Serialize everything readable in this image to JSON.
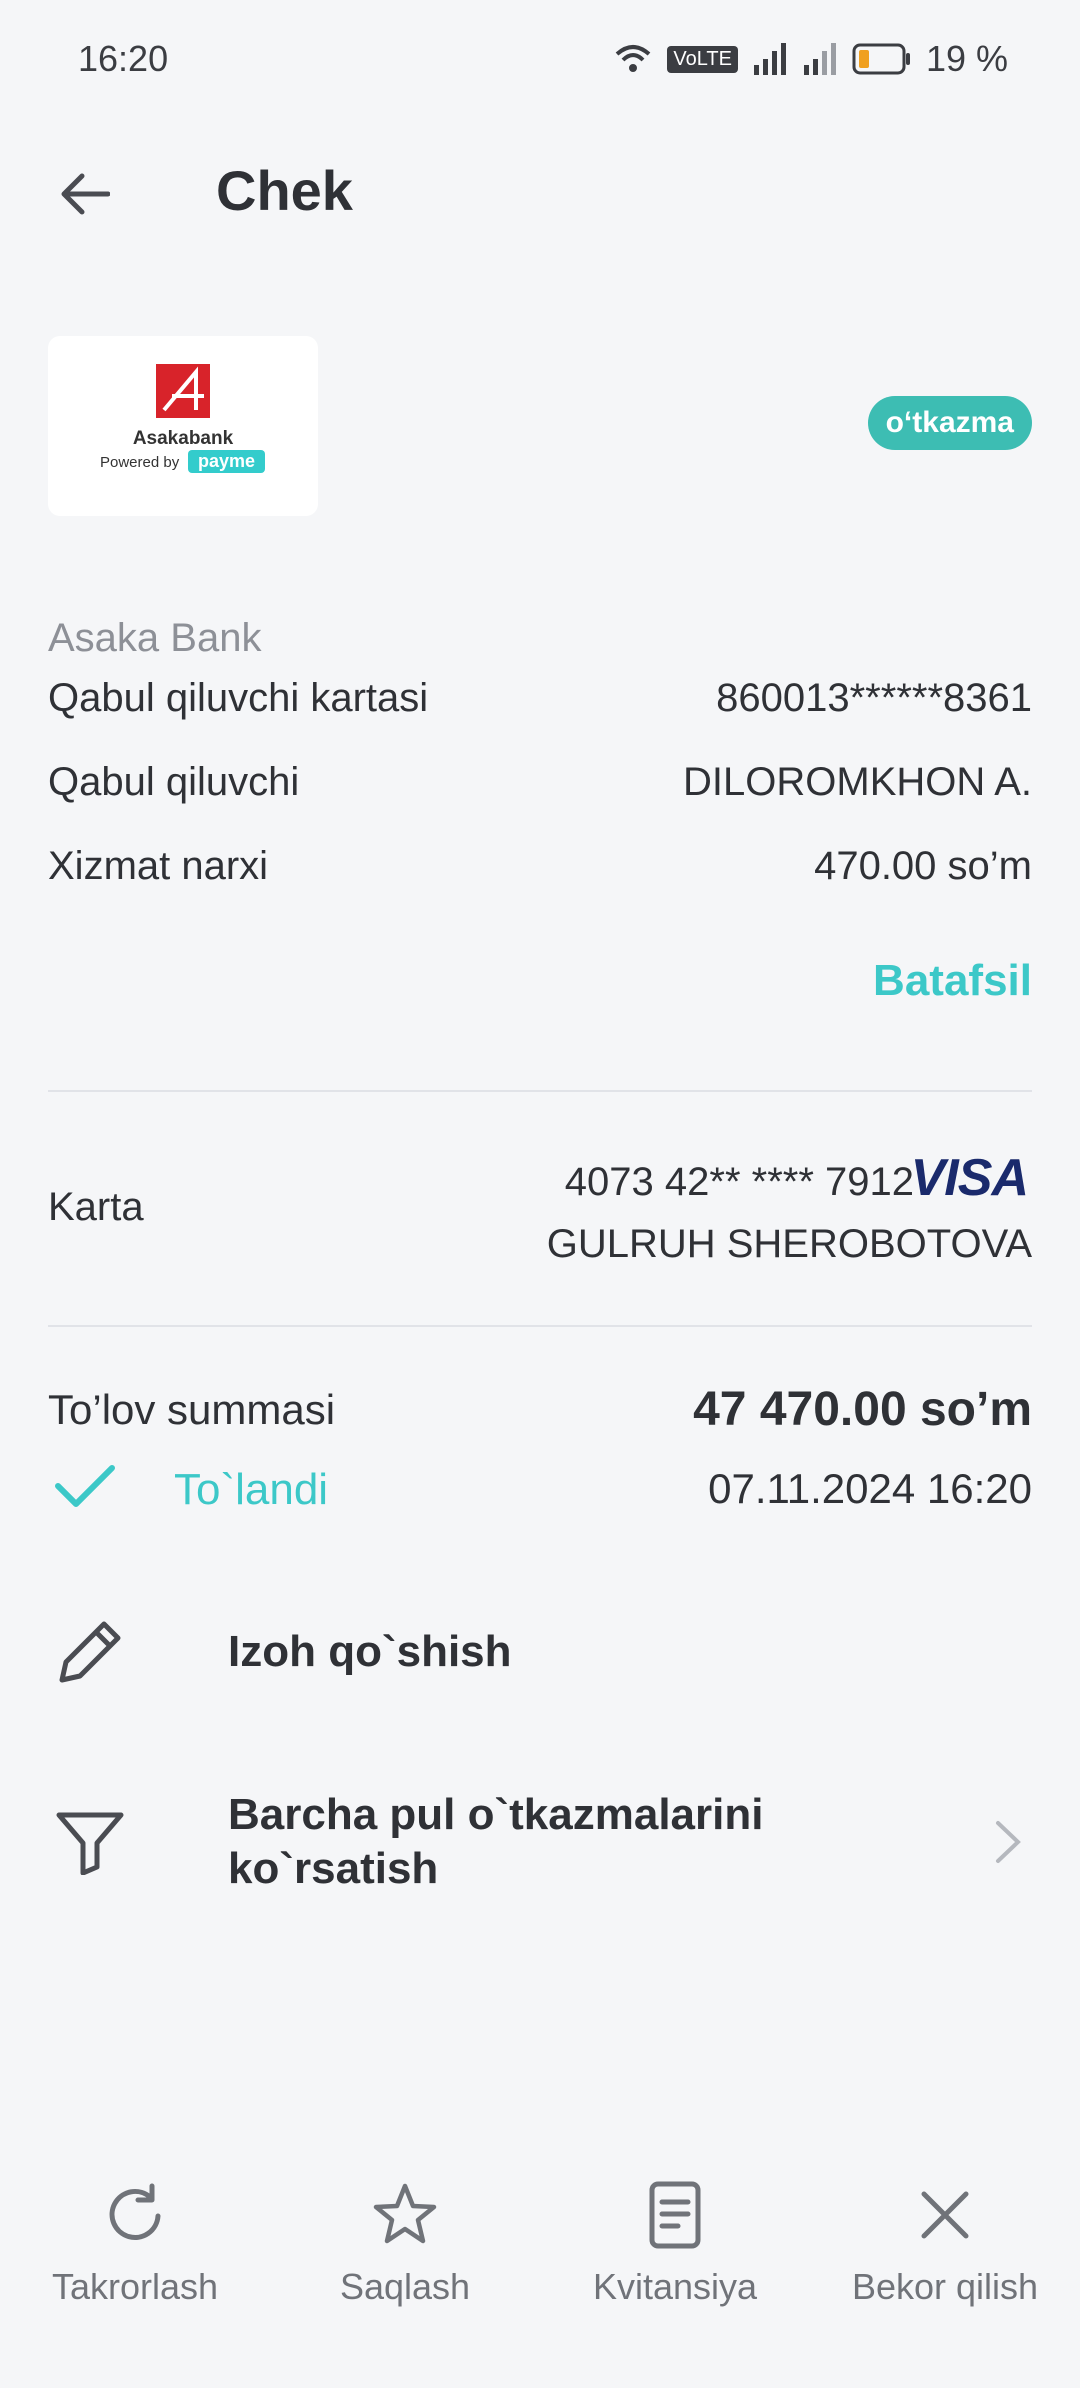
{
  "status_bar": {
    "time": "16:20",
    "battery": "19 %",
    "network": "VoLTE"
  },
  "header": {
    "title": "Chek"
  },
  "logo": {
    "bank_name": "Asakabank",
    "powered_by": "Powered by",
    "brand": "payme"
  },
  "badge": "o‘tkazma",
  "provider": "Asaka Bank",
  "details": [
    {
      "label": "Qabul qiluvchi kartasi",
      "value": "860013******8361"
    },
    {
      "label": "Qabul qiluvchi",
      "value": "DILOROMKHON A."
    },
    {
      "label": "Xizmat narxi",
      "value": "470.00 so’m"
    }
  ],
  "more_link": "Batafsil",
  "card": {
    "label": "Karta",
    "number": "4073 42** **** 7912",
    "brand": "VISA",
    "holder": "GULRUH SHEROBOTOVA"
  },
  "payment": {
    "label": "To’lov summasi",
    "amount": "47 470.00 so’m",
    "status": "To`landi",
    "datetime": "07.11.2024 16:20"
  },
  "actions": [
    {
      "label": "Izoh qo`shish",
      "icon": "pencil-icon"
    },
    {
      "label": "Barcha pul o`tkazmalarini ko`rsatish",
      "icon": "filter-icon"
    }
  ],
  "bottom_bar": [
    {
      "label": "Takrorlash",
      "icon": "repeat-icon"
    },
    {
      "label": "Saqlash",
      "icon": "star-icon"
    },
    {
      "label": "Kvitansiya",
      "icon": "receipt-icon"
    },
    {
      "label": "Bekor qilish",
      "icon": "close-icon"
    }
  ],
  "colors": {
    "accent": "#3cc8c8",
    "badge": "#3dbdb3",
    "background": "#f5f6f8",
    "visa": "#1a2a6c"
  }
}
